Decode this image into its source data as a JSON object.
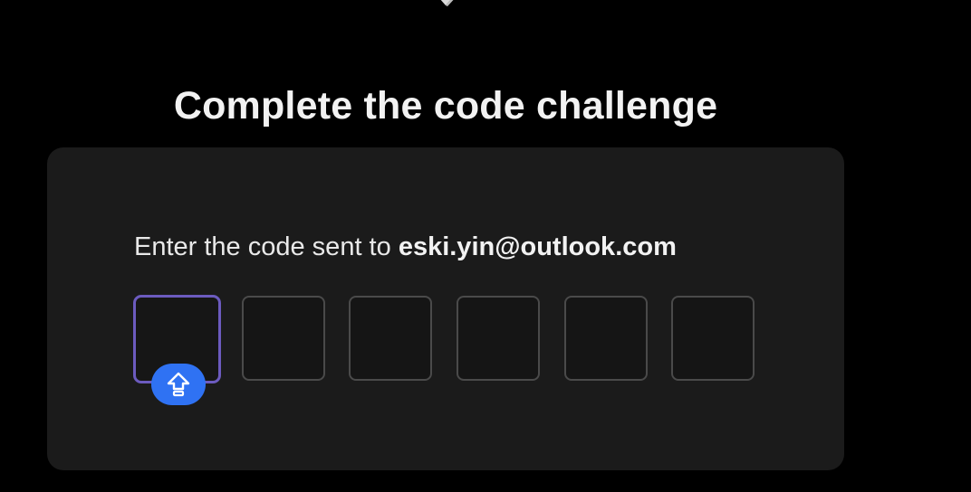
{
  "header": {
    "title": "Complete the code challenge"
  },
  "card": {
    "prompt_prefix": "Enter the code sent to ",
    "email": "eski.yin@outlook.com",
    "code_boxes": [
      "",
      "",
      "",
      "",
      "",
      ""
    ],
    "active_index": 0
  },
  "indicator": {
    "icon": "caps-lock-icon"
  },
  "colors": {
    "background": "#000000",
    "card": "#1b1b1b",
    "active_border": "#6c5bbf",
    "badge": "#2f72f3"
  }
}
